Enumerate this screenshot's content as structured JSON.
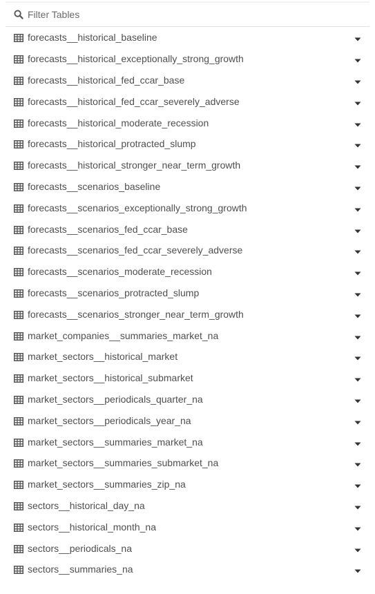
{
  "filter": {
    "placeholder": "Filter Tables",
    "icon": "search-icon"
  },
  "tables": [
    {
      "name": "forecasts__historical_baseline",
      "icon": "table-icon",
      "action_icon": "caret-down-icon"
    },
    {
      "name": "forecasts__historical_exceptionally_strong_growth",
      "icon": "table-icon",
      "action_icon": "caret-down-icon"
    },
    {
      "name": "forecasts__historical_fed_ccar_base",
      "icon": "table-icon",
      "action_icon": "caret-down-icon"
    },
    {
      "name": "forecasts__historical_fed_ccar_severely_adverse",
      "icon": "table-icon",
      "action_icon": "caret-down-icon"
    },
    {
      "name": "forecasts__historical_moderate_recession",
      "icon": "table-icon",
      "action_icon": "caret-down-icon"
    },
    {
      "name": "forecasts__historical_protracted_slump",
      "icon": "table-icon",
      "action_icon": "caret-down-icon"
    },
    {
      "name": "forecasts__historical_stronger_near_term_growth",
      "icon": "table-icon",
      "action_icon": "caret-down-icon"
    },
    {
      "name": "forecasts__scenarios_baseline",
      "icon": "table-icon",
      "action_icon": "caret-down-icon"
    },
    {
      "name": "forecasts__scenarios_exceptionally_strong_growth",
      "icon": "table-icon",
      "action_icon": "caret-down-icon"
    },
    {
      "name": "forecasts__scenarios_fed_ccar_base",
      "icon": "table-icon",
      "action_icon": "caret-down-icon"
    },
    {
      "name": "forecasts__scenarios_fed_ccar_severely_adverse",
      "icon": "table-icon",
      "action_icon": "caret-down-icon"
    },
    {
      "name": "forecasts__scenarios_moderate_recession",
      "icon": "table-icon",
      "action_icon": "caret-down-icon"
    },
    {
      "name": "forecasts__scenarios_protracted_slump",
      "icon": "table-icon",
      "action_icon": "caret-down-icon"
    },
    {
      "name": "forecasts__scenarios_stronger_near_term_growth",
      "icon": "table-icon",
      "action_icon": "caret-down-icon"
    },
    {
      "name": "market_companies__summaries_market_na",
      "icon": "table-icon",
      "action_icon": "caret-down-icon"
    },
    {
      "name": "market_sectors__historical_market",
      "icon": "table-icon",
      "action_icon": "caret-down-icon"
    },
    {
      "name": "market_sectors__historical_submarket",
      "icon": "table-icon",
      "action_icon": "caret-down-icon"
    },
    {
      "name": "market_sectors__periodicals_quarter_na",
      "icon": "table-icon",
      "action_icon": "caret-down-icon"
    },
    {
      "name": "market_sectors__periodicals_year_na",
      "icon": "table-icon",
      "action_icon": "caret-down-icon"
    },
    {
      "name": "market_sectors__summaries_market_na",
      "icon": "table-icon",
      "action_icon": "caret-down-icon"
    },
    {
      "name": "market_sectors__summaries_submarket_na",
      "icon": "table-icon",
      "action_icon": "caret-down-icon"
    },
    {
      "name": "market_sectors__summaries_zip_na",
      "icon": "table-icon",
      "action_icon": "caret-down-icon"
    },
    {
      "name": "sectors__historical_day_na",
      "icon": "table-icon",
      "action_icon": "caret-down-icon"
    },
    {
      "name": "sectors__historical_month_na",
      "icon": "table-icon",
      "action_icon": "caret-down-icon"
    },
    {
      "name": "sectors__periodicals_na",
      "icon": "table-icon",
      "action_icon": "caret-down-icon"
    },
    {
      "name": "sectors__summaries_na",
      "icon": "table-icon",
      "action_icon": "caret-down-icon"
    }
  ]
}
